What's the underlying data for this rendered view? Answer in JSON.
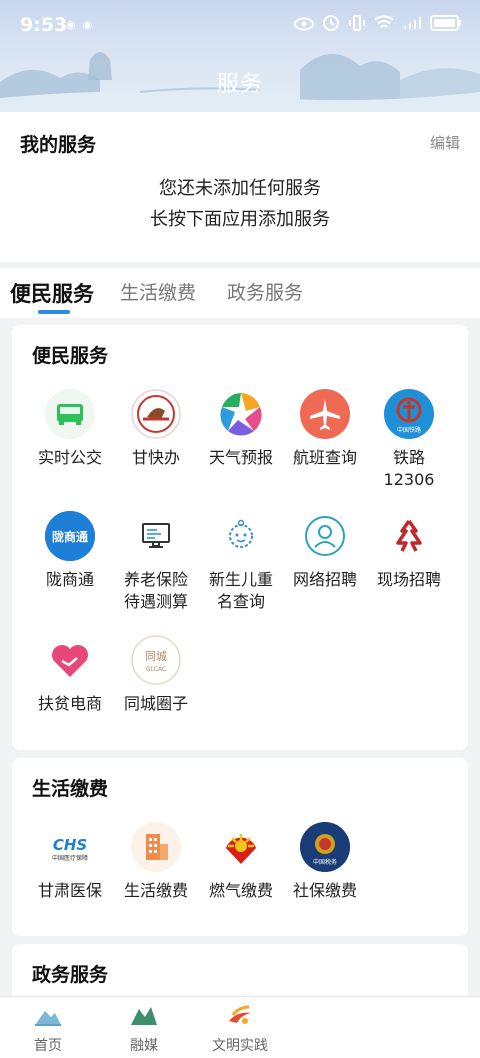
{
  "status_bar": {
    "time": "9:53"
  },
  "header": {
    "title": "服务"
  },
  "my_services": {
    "title": "我的服务",
    "edit_label": "编辑",
    "empty_line1": "您还未添加任何服务",
    "empty_line2": "长按下面应用添加服务"
  },
  "tabs": [
    {
      "label": "便民服务",
      "active": true
    },
    {
      "label": "生活缴费",
      "active": false
    },
    {
      "label": "政务服务",
      "active": false
    }
  ],
  "sections": {
    "convenience": {
      "title": "便民服务",
      "items": [
        {
          "label": "实时公交",
          "icon": "bus-icon"
        },
        {
          "label": "甘快办",
          "icon": "gankuaiban-icon"
        },
        {
          "label": "天气预报",
          "icon": "weather-icon"
        },
        {
          "label": "航班查询",
          "icon": "airplane-icon"
        },
        {
          "label": "铁路",
          "label2": "12306",
          "icon": "railway-icon"
        },
        {
          "label": "陇商通",
          "icon": "longshangtong-icon"
        },
        {
          "label": "养老保险",
          "label2": "待遇测算",
          "icon": "computer-icon"
        },
        {
          "label": "新生儿重",
          "label2": "名查询",
          "icon": "baby-icon"
        },
        {
          "label": "网络招聘",
          "icon": "person-icon"
        },
        {
          "label": "现场招聘",
          "icon": "recruit-icon"
        },
        {
          "label": "扶贫电商",
          "icon": "handshake-heart-icon"
        },
        {
          "label": "同城圈子",
          "icon": "tongcheng-icon"
        }
      ]
    },
    "payment": {
      "title": "生活缴费",
      "items": [
        {
          "label": "甘肃医保",
          "icon": "chs-icon"
        },
        {
          "label": "生活缴费",
          "icon": "building-icon"
        },
        {
          "label": "燃气缴费",
          "icon": "petrochina-icon"
        },
        {
          "label": "社保缴费",
          "icon": "tax-emblem-icon"
        }
      ]
    },
    "government": {
      "title": "政务服务"
    }
  },
  "bottom_nav": [
    {
      "label": "首页",
      "icon": "home-mountain-icon"
    },
    {
      "label": "融媒",
      "icon": "media-mountain-icon"
    },
    {
      "label": "文明实践",
      "icon": "civilization-icon"
    }
  ],
  "colors": {
    "accent": "#2a8be0",
    "header_bg": "#c8d6ee"
  }
}
